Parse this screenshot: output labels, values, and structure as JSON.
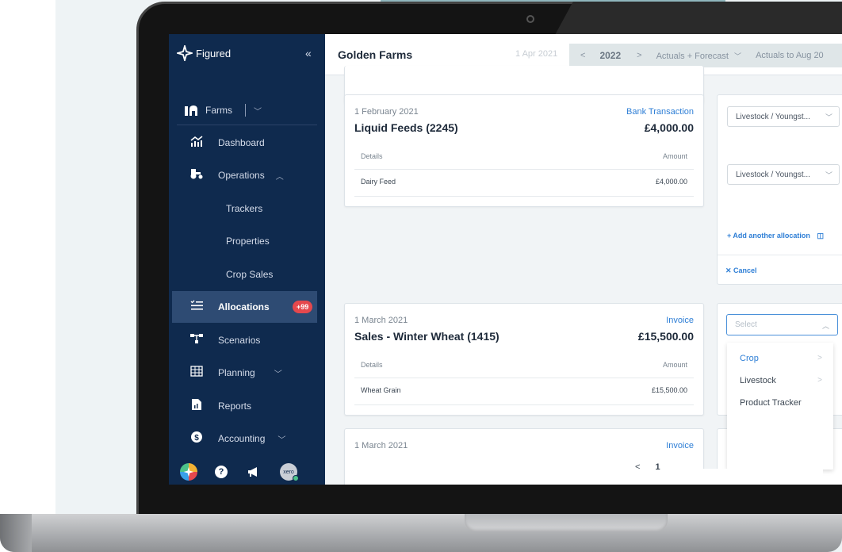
{
  "app": {
    "logo_text": "Figured",
    "collapse_glyph": "«"
  },
  "sidebar": {
    "farms_label": "Farms",
    "items": [
      {
        "label": "Dashboard",
        "icon": "chart-icon"
      },
      {
        "label": "Operations",
        "icon": "tractor-icon",
        "caret": "^"
      },
      {
        "label": "Trackers"
      },
      {
        "label": "Properties"
      },
      {
        "label": "Crop Sales"
      },
      {
        "label": "Allocations",
        "icon": "list-icon",
        "badge": "+99"
      },
      {
        "label": "Scenarios",
        "icon": "scenarios-icon"
      },
      {
        "label": "Planning",
        "icon": "grid-icon",
        "caret": "v"
      },
      {
        "label": "Reports",
        "icon": "report-icon"
      },
      {
        "label": "Accounting",
        "icon": "dollar-icon",
        "caret": "v"
      }
    ],
    "bottom_icons": [
      "figured-icon",
      "help-icon",
      "megaphone-icon",
      "xero-icon"
    ],
    "xero_text": "xero"
  },
  "header": {
    "title": "Golden Farms",
    "date_start": "1 Apr 2021",
    "year": "2022",
    "mode": "Actuals + Forecast",
    "actuals_to": "Actuals to Aug 20"
  },
  "cards": [
    {
      "date": "1 February 2021",
      "type": "Bank Transaction",
      "title": "Liquid Feeds (2245)",
      "amount": "£4,000.00",
      "col_details": "Details",
      "col_amount": "Amount",
      "row_detail": "Dairy Feed",
      "row_amount": "£4,000.00"
    },
    {
      "date": "1 March 2021",
      "type": "Invoice",
      "title": "Sales - Winter Wheat (1415)",
      "amount": "£15,500.00",
      "col_details": "Details",
      "col_amount": "Amount",
      "row_detail": "Wheat Grain",
      "row_amount": "£15,500.00"
    },
    {
      "date": "1 March 2021",
      "type": "Invoice"
    }
  ],
  "allocation": {
    "select_1": "Livestock / Youngst...",
    "select_2": "Livestock / Youngst...",
    "add_another": "+ Add another allocation",
    "cancel": "✕ Cancel",
    "select_placeholder": "Select",
    "dropdown_options": [
      "Crop",
      "Livestock",
      "Product Tracker"
    ]
  },
  "pager": {
    "prev": "<",
    "page": "1"
  },
  "colors": {
    "sidebar_bg": "#0f2a4e",
    "active_bg": "#2e4b73",
    "accent_blue": "#2f7fd6",
    "badge_red": "#e5484d"
  }
}
